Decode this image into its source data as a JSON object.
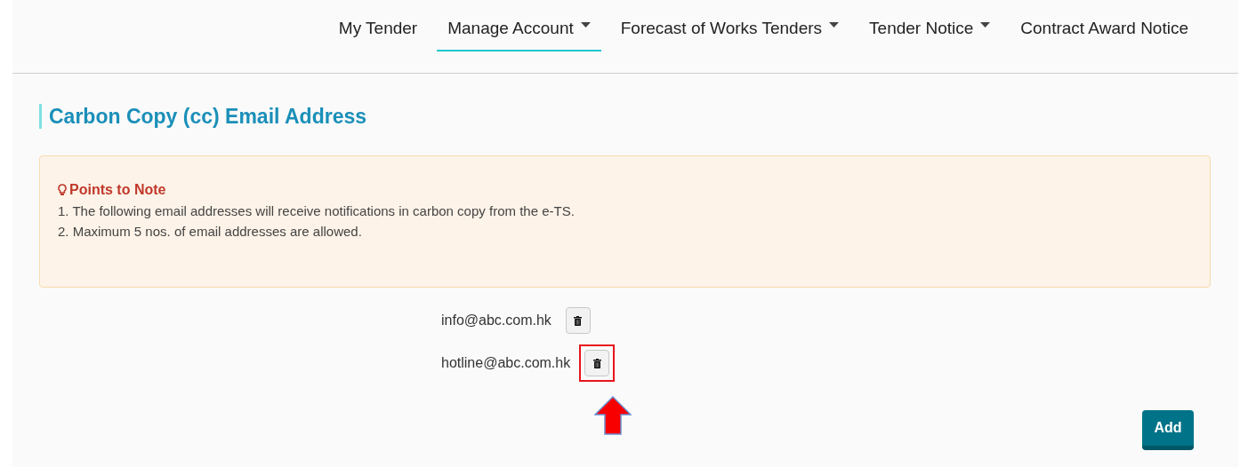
{
  "nav": [
    {
      "label": "My Tender",
      "selected": false,
      "dropdown": false
    },
    {
      "label": "Manage Account",
      "selected": true,
      "dropdown": true
    },
    {
      "label": "Forecast of Works Tenders",
      "selected": false,
      "dropdown": true
    },
    {
      "label": "Tender Notice",
      "selected": false,
      "dropdown": true
    },
    {
      "label": "Contract Award Notice",
      "selected": false,
      "dropdown": false
    }
  ],
  "heading": "Carbon Copy (cc) Email Address",
  "notice": {
    "title": "Points to Note",
    "lines": [
      "1. The following email addresses will receive notifications in carbon copy from the e-TS.",
      "2. Maximum 5 nos. of email addresses are allowed."
    ]
  },
  "emails": [
    {
      "address": "info@abc.com.hk",
      "highlighted": false
    },
    {
      "address": "hotline@abc.com.hk",
      "highlighted": true
    }
  ],
  "add_button": "Add"
}
